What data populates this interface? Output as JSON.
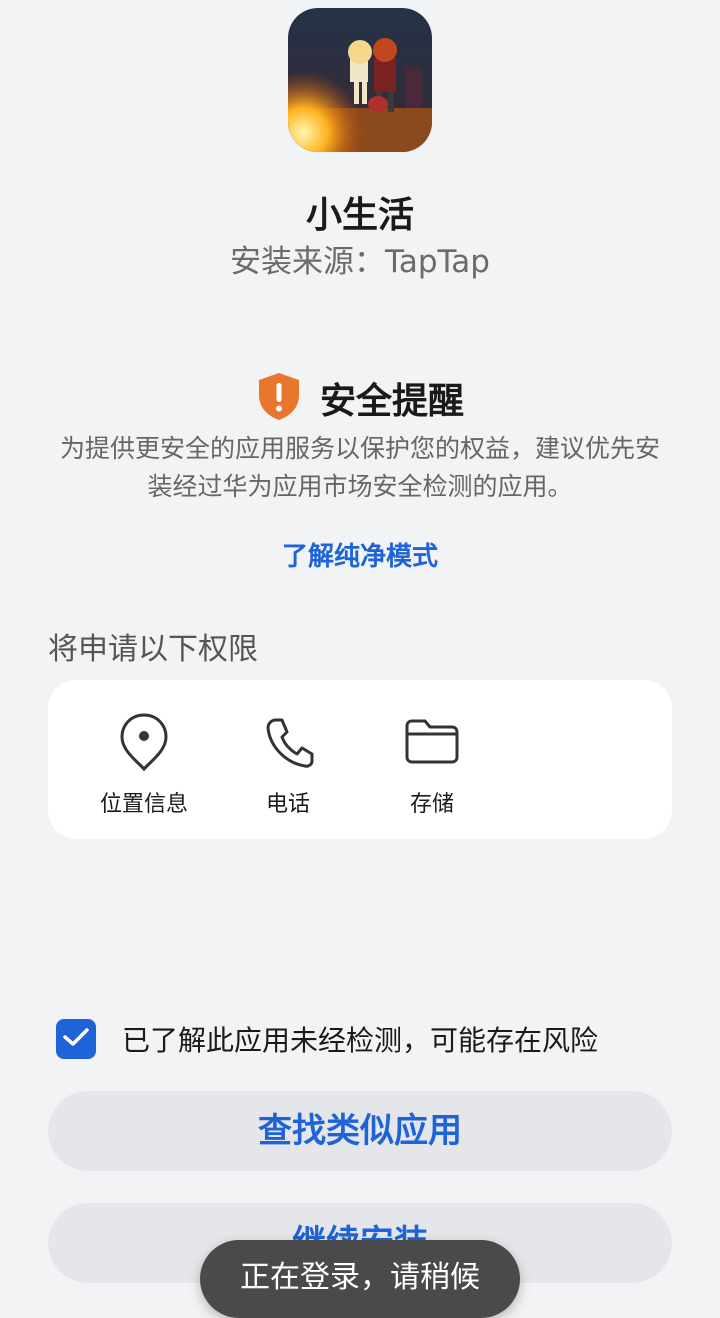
{
  "app": {
    "name": "小生活",
    "install_source": "安装来源：TapTap"
  },
  "warning": {
    "icon": "shield-alert-icon",
    "title": "安全提醒",
    "text": "为提供更安全的应用服务以保护您的权益，建议优先安装经过华为应用市场安全检测的应用。",
    "learn_more": "了解纯净模式"
  },
  "permissions": {
    "heading": "将申请以下权限",
    "items": [
      {
        "icon": "location-pin-icon",
        "label": "位置信息"
      },
      {
        "icon": "phone-icon",
        "label": "电话"
      },
      {
        "icon": "folder-icon",
        "label": "存储"
      }
    ]
  },
  "consent": {
    "checked": true,
    "text": "已了解此应用未经检测，可能存在风险"
  },
  "buttons": {
    "find_similar": "查找类似应用",
    "continue_install": "继续安装"
  },
  "toast": {
    "text": "正在登录，请稍候"
  },
  "colors": {
    "accent": "#1e63d8",
    "warning": "#e8762c",
    "background": "#f1f3f5"
  }
}
